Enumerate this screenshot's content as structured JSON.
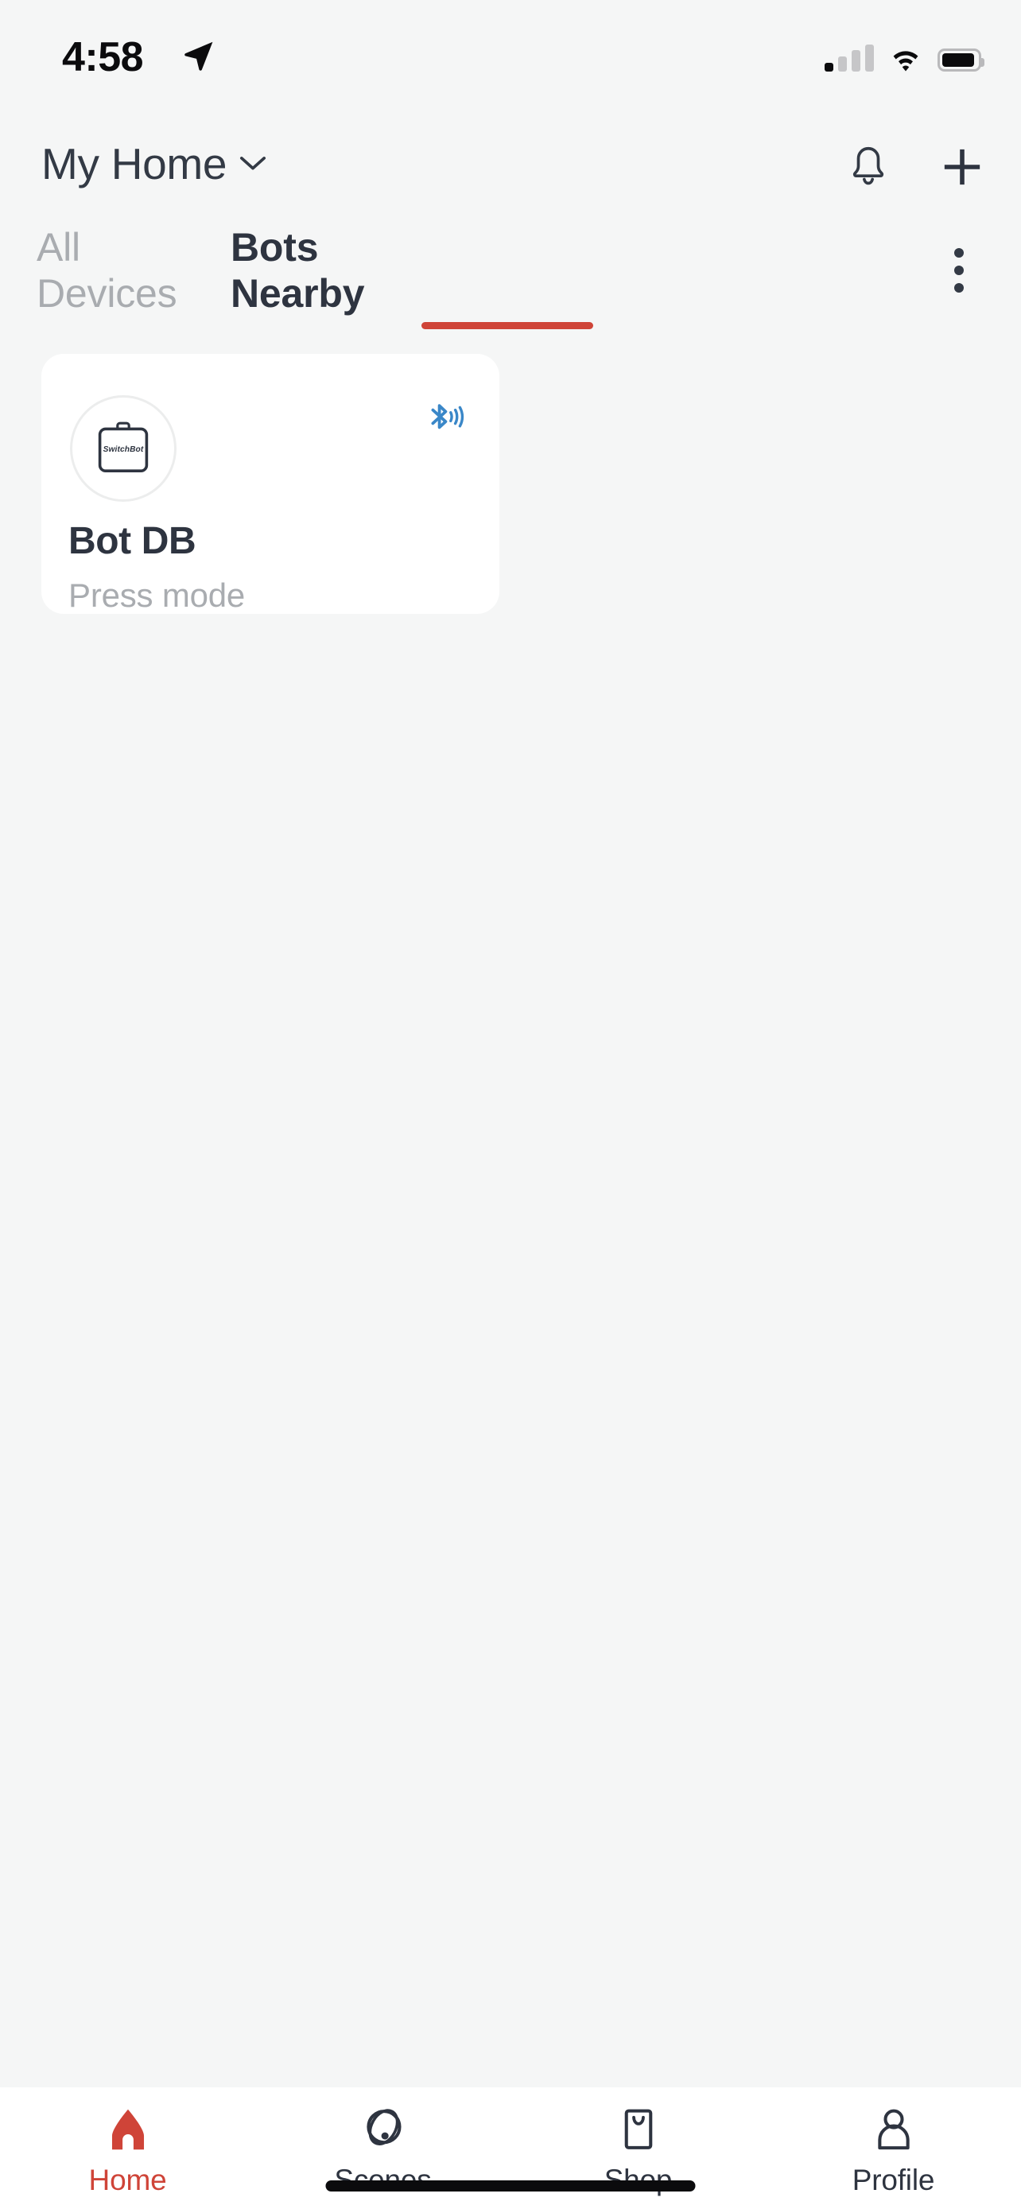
{
  "status_bar": {
    "time": "4:58",
    "location_icon": "location-arrow-icon",
    "cellular_icon": "cellular-signal-icon",
    "cellular_bars_filled": 1,
    "cellular_bars_total": 4,
    "wifi_icon": "wifi-icon",
    "battery_icon": "battery-icon",
    "battery_level_percent": 92
  },
  "header": {
    "home_name": "My Home",
    "chevron_icon": "chevron-down-icon",
    "notification_icon": "bell-icon",
    "add_icon": "plus-icon"
  },
  "tabs": {
    "items": [
      {
        "label": "All Devices",
        "active": false
      },
      {
        "label": "Bots Nearby",
        "active": true
      }
    ],
    "active_index": 1,
    "underline_color": "#cf4438",
    "overflow_icon": "kebab-menu-icon"
  },
  "devices": [
    {
      "name": "Bot DB",
      "status": "Press mode",
      "device_icon": "switchbot-bot-icon",
      "device_icon_label": "SwitchBot",
      "connection_icon": "bluetooth-signal-icon",
      "connection_color": "#3a87c8"
    }
  ],
  "bottom_nav": {
    "items": [
      {
        "label": "Home",
        "icon": "home-icon",
        "active": true
      },
      {
        "label": "Scenes",
        "icon": "scenes-orbit-icon",
        "active": false
      },
      {
        "label": "Shop",
        "icon": "shopping-bag-icon",
        "active": false
      },
      {
        "label": "Profile",
        "icon": "person-icon",
        "active": false
      }
    ],
    "active_color": "#cf4438",
    "inactive_color": "#2e3440"
  },
  "colors": {
    "page_background": "#f5f6f6",
    "card_background": "#ffffff",
    "accent": "#cf4438",
    "text_primary": "#2e3440",
    "text_muted": "#a9acb0",
    "bluetooth": "#3a87c8"
  }
}
